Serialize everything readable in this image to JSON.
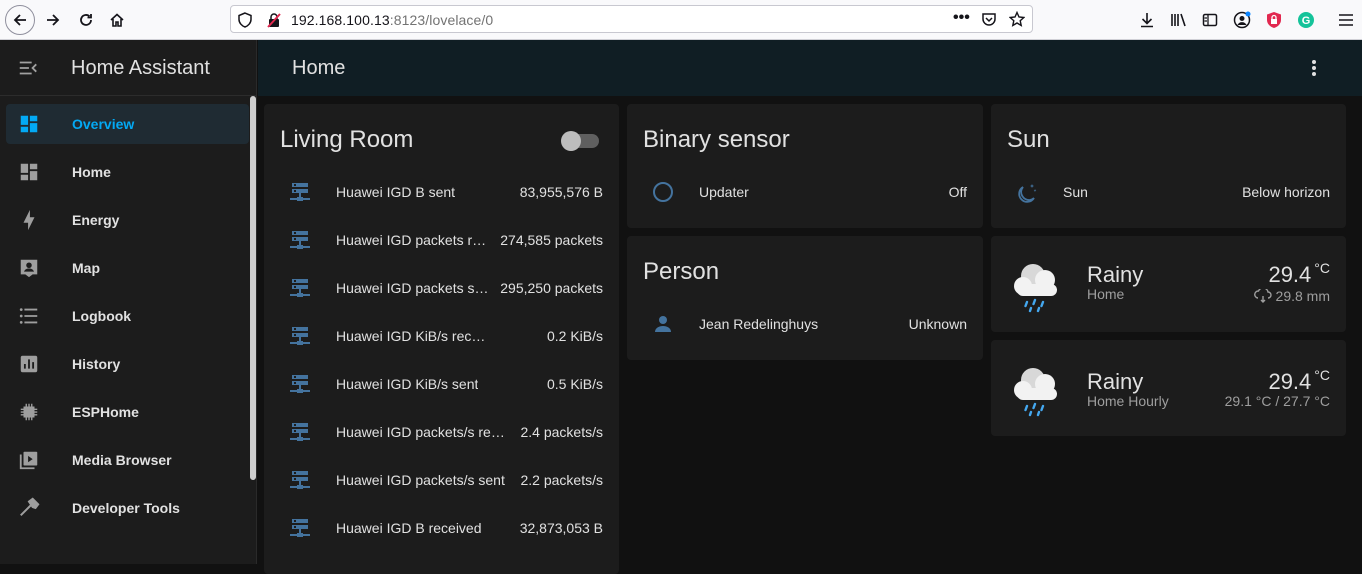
{
  "browser": {
    "url_host": "192.168.100.13",
    "url_path": ":8123/lovelace/0"
  },
  "sidebar": {
    "title": "Home Assistant",
    "items": [
      {
        "label": "Overview",
        "icon": "dashboard-icon"
      },
      {
        "label": "Home",
        "icon": "dashboard-icon"
      },
      {
        "label": "Energy",
        "icon": "lightning-bolt-icon"
      },
      {
        "label": "Map",
        "icon": "map-account-icon"
      },
      {
        "label": "Logbook",
        "icon": "format-list-icon"
      },
      {
        "label": "History",
        "icon": "chart-box-icon"
      },
      {
        "label": "ESPHome",
        "icon": "chip-icon"
      },
      {
        "label": "Media Browser",
        "icon": "play-box-icon"
      },
      {
        "label": "Developer Tools",
        "icon": "hammer-icon"
      }
    ]
  },
  "header": {
    "title": "Home"
  },
  "cards": {
    "living_room": {
      "title": "Living Room",
      "rows": [
        {
          "name": "Huawei IGD B sent",
          "value": "83,955,576 B"
        },
        {
          "name": "Huawei IGD packets received",
          "value": "274,585 packets"
        },
        {
          "name": "Huawei IGD packets sent",
          "value": "295,250 packets"
        },
        {
          "name": "Huawei IGD KiB/s received",
          "value": "0.2 KiB/s"
        },
        {
          "name": "Huawei IGD KiB/s sent",
          "value": "0.5 KiB/s"
        },
        {
          "name": "Huawei IGD packets/s received",
          "value": "2.4 packets/s"
        },
        {
          "name": "Huawei IGD packets/s sent",
          "value": "2.2 packets/s"
        },
        {
          "name": "Huawei IGD B received",
          "value": "32,873,053 B"
        }
      ]
    },
    "binary_sensor": {
      "title": "Binary sensor",
      "row": {
        "name": "Updater",
        "value": "Off"
      }
    },
    "person": {
      "title": "Person",
      "row": {
        "name": "Jean Redelinghuys",
        "value": "Unknown"
      }
    },
    "sun": {
      "title": "Sun",
      "row": {
        "name": "Sun",
        "value": "Below horizon"
      }
    },
    "weather_home": {
      "state": "Rainy",
      "name": "Home",
      "temp": "29.4",
      "unit": "°C",
      "precip": "29.8 mm"
    },
    "weather_hourly": {
      "state": "Rainy",
      "name": "Home Hourly",
      "temp": "29.4",
      "unit": "°C",
      "range": "29.1 °C / 27.7 °C"
    }
  },
  "colors": {
    "accent": "#03a9f4",
    "icon": "#44739e",
    "card": "#1c1c1c",
    "background": "#111111"
  }
}
